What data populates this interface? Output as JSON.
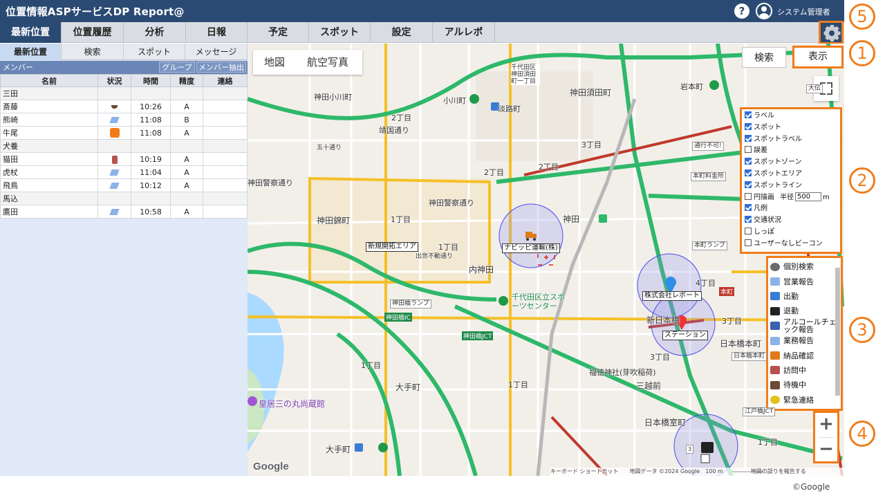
{
  "app": {
    "title": "位置情報ASPサービスDP Report@",
    "help_icon": "?",
    "user": "システム管理者"
  },
  "nav": {
    "tabs": [
      "最新位置",
      "位置履歴",
      "分析",
      "日報",
      "予定",
      "スポット",
      "設定",
      "アルレポ"
    ],
    "active": "最新位置"
  },
  "subtabs": [
    "最新位置",
    "検索",
    "スポット",
    "メッセージ"
  ],
  "members": {
    "section_label": "メンバー",
    "group_button": "グループ",
    "extract_button": "メンバー抽出",
    "columns": [
      "名前",
      "状況",
      "時間",
      "精度",
      "連絡"
    ],
    "rows": [
      {
        "name": "三田",
        "status": "",
        "time": "",
        "precision": "",
        "contact": "",
        "group": true
      },
      {
        "name": "斎藤",
        "status": "coffee-icon",
        "time": "10:26",
        "precision": "A",
        "contact": ""
      },
      {
        "name": "熊崎",
        "status": "pen-icon",
        "time": "11:08",
        "precision": "B",
        "contact": ""
      },
      {
        "name": "牛尾",
        "status": "orange-icon",
        "time": "11:08",
        "precision": "A",
        "contact": ""
      },
      {
        "name": "犬養",
        "status": "",
        "time": "",
        "precision": "",
        "contact": "",
        "group": true
      },
      {
        "name": "猫田",
        "status": "visit-icon",
        "time": "10:19",
        "precision": "A",
        "contact": ""
      },
      {
        "name": "虎杖",
        "status": "pen-icon",
        "time": "11:04",
        "precision": "A",
        "contact": ""
      },
      {
        "name": "飛鳥",
        "status": "pen-icon",
        "time": "10:12",
        "precision": "A",
        "contact": ""
      },
      {
        "name": "馬込",
        "status": "",
        "time": "",
        "precision": "",
        "contact": "",
        "group": true
      },
      {
        "name": "鷹田",
        "status": "pen-icon",
        "time": "10:58",
        "precision": "A",
        "contact": ""
      }
    ]
  },
  "map": {
    "type_map": "地図",
    "type_satellite": "航空写真",
    "search_button": "検索",
    "display_button": "表示",
    "layers": [
      {
        "label": "ラベル",
        "checked": true
      },
      {
        "label": "スポット",
        "checked": true
      },
      {
        "label": "スポットラベル",
        "checked": true
      },
      {
        "label": "誤差",
        "checked": false
      },
      {
        "label": "スポットゾーン",
        "checked": true
      },
      {
        "label": "スポットエリア",
        "checked": true
      },
      {
        "label": "スポットライン",
        "checked": true
      },
      {
        "label": "円描画",
        "checked": false,
        "radius_label": "半径",
        "radius_value": "500",
        "radius_unit": "m"
      },
      {
        "label": "凡例",
        "checked": true
      },
      {
        "label": "交通状況",
        "checked": true
      },
      {
        "label": "しっぽ",
        "checked": false
      },
      {
        "label": "ユーザーなしビーコン",
        "checked": false
      }
    ],
    "legend": [
      {
        "icon": "search-person-icon",
        "label": "個別検索",
        "color": "#6b6b6b"
      },
      {
        "icon": "pen-icon",
        "label": "営業報告",
        "color": "#8ab4e8"
      },
      {
        "icon": "walk-in-icon",
        "label": "出勤",
        "color": "#3a7bd5"
      },
      {
        "icon": "walk-out-icon",
        "label": "退勤",
        "color": "#222222"
      },
      {
        "icon": "alcohol-icon",
        "label": "アルコールチェック報告",
        "color": "#3a60b0"
      },
      {
        "icon": "pen-icon",
        "label": "業務報告",
        "color": "#8ab4e8"
      },
      {
        "icon": "truck-icon",
        "label": "納品確認",
        "color": "#e07a1a"
      },
      {
        "icon": "visit-icon",
        "label": "訪問中",
        "color": "#b85050"
      },
      {
        "icon": "coffee-icon",
        "label": "待機中",
        "color": "#6b4b33"
      },
      {
        "icon": "alert-icon",
        "label": "緊急連絡",
        "color": "#e0c21a"
      }
    ],
    "zoom_in": "+",
    "zoom_out": "−",
    "google_logo": "Google",
    "attribution": "キーボード ショートカット　　地図データ ©2024 Google　100 m　　　　　地図の誤りを報告する",
    "labels": {
      "l1": "神田小川町",
      "l2": "小川町",
      "l3": "淡路町",
      "l4": "神田須田町",
      "l5": "千代田区神田須田町一丁目",
      "l6": "岩本町",
      "l7": "2丁目",
      "l8": "靖国通り",
      "l9": "五十通り",
      "l10": "3丁目",
      "l11": "2丁目",
      "l12": "2丁目",
      "l13": "神田警察通り",
      "l14": "神田警察通り",
      "l15": "神田錦町",
      "l16": "1丁目",
      "l17": "1丁目",
      "l18": "出世不動通り",
      "l19": "内神田",
      "l20": "神田",
      "l21": "千代田区立スポーツセンター",
      "l22": "神田橋IC",
      "l23": "神田橋JCT",
      "l24": "1丁目",
      "l25": "1丁目",
      "l26": "大手町",
      "l27": "福徳神社(芽吹稲荷)",
      "l28": "三越前",
      "l29": "日本橋本町",
      "l30": "日本橋室町",
      "l31": "新日本橋",
      "l32": "3丁目",
      "l33": "4丁目",
      "l34": "1丁目",
      "l35": "大手町",
      "l36": "皇居三の丸尚蔵館",
      "l37": "本町",
      "l38": "3丁目"
    },
    "boxes": {
      "b1": "通行不可!",
      "b2": "本町料金所",
      "b3": "本町ランプ",
      "b4": "神田橋ランプ",
      "b5": "日本橋本町",
      "b6": "江戸橋JCT",
      "b7": "大伝",
      "b8": "4丁目"
    },
    "tags": {
      "t1": "新規開拓エリア",
      "t2": "ナビッピ運輸(株)",
      "t3": "株式会社レポート",
      "t4": "ステーション"
    },
    "marker_count": "3",
    "marker_count2": "2"
  },
  "callouts": [
    "1",
    "2",
    "3",
    "4",
    "5"
  ],
  "copyright": "©Google",
  "colors": {
    "header": "#2b4a73",
    "accent_orange": "#f07c1a",
    "road_green": "#2eb86a",
    "road_yellow": "#f5c028",
    "road_red": "#c0392b"
  }
}
